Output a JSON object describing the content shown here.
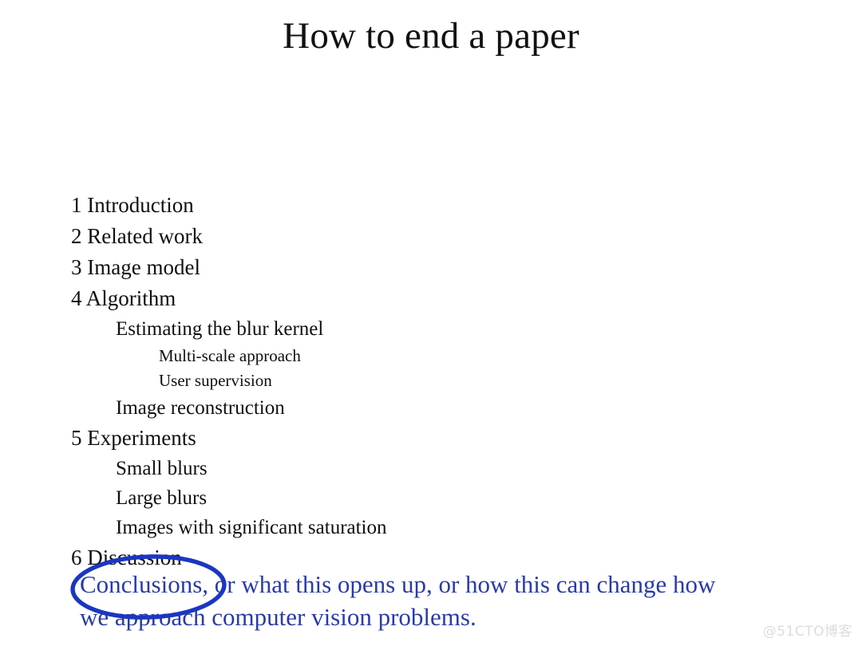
{
  "slide": {
    "title": "How to end a paper",
    "background_color": "#ffffff",
    "text_color": "#101010"
  },
  "outline": {
    "items": [
      {
        "level": 0,
        "text": "1 Introduction"
      },
      {
        "level": 0,
        "text": "2 Related work"
      },
      {
        "level": 0,
        "text": "3 Image model"
      },
      {
        "level": 0,
        "text": "4 Algorithm"
      },
      {
        "level": 1,
        "text": "Estimating the blur kernel"
      },
      {
        "level": 2,
        "text": "Multi-scale approach"
      },
      {
        "level": 2,
        "text": "User supervision"
      },
      {
        "level": 1,
        "text": "Image reconstruction"
      },
      {
        "level": 0,
        "text": "5 Experiments"
      },
      {
        "level": 1,
        "text": "Small blurs"
      },
      {
        "level": 1,
        "text": "Large blurs"
      },
      {
        "level": 1,
        "text": "Images with significant saturation"
      },
      {
        "level": 0,
        "text": "6 Discussion"
      }
    ]
  },
  "annotation": {
    "color": "#2a3aa8",
    "lines": [
      "Conclusions, or what this opens up, or how this can change how",
      "we approach computer vision problems."
    ],
    "circled_word": "Conclusions",
    "ellipse_color": "#1a37c0"
  },
  "watermark": {
    "text": "@51CTO博客",
    "color": "#dcdcdc"
  }
}
